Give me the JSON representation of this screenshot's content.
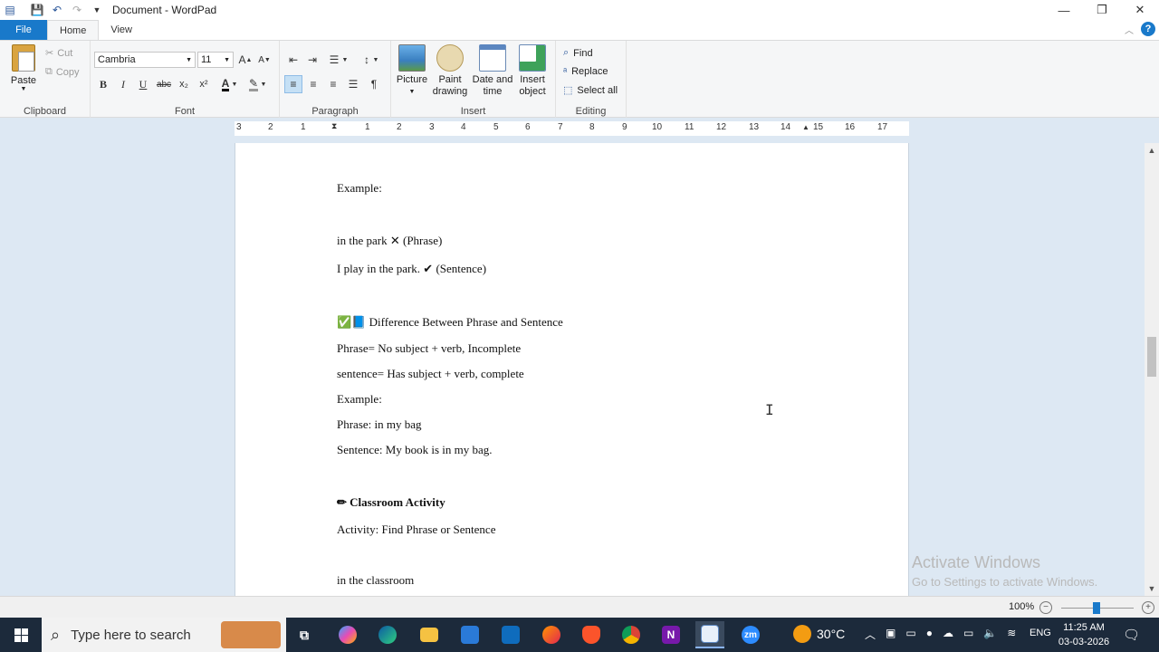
{
  "window": {
    "title": "Document - WordPad",
    "controls": [
      "—",
      "❐",
      "✕"
    ]
  },
  "ribbon_tabs": {
    "file": "File",
    "home": "Home",
    "view": "View"
  },
  "clipboard": {
    "paste": "Paste",
    "cut": "Cut",
    "copy": "Copy",
    "group": "Clipboard"
  },
  "font": {
    "family": "Cambria",
    "size": "11",
    "bold": "B",
    "italic": "I",
    "underline": "U",
    "strike": "abc",
    "subscript": "x₂",
    "superscript": "x²",
    "color": "A",
    "highlight": "✎",
    "grow": "A",
    "shrink": "A",
    "group": "Font"
  },
  "paragraph": {
    "group": "Paragraph"
  },
  "insert": {
    "picture": "Picture",
    "paint_line1": "Paint",
    "paint_line2": "drawing",
    "datetime_line1": "Date and",
    "datetime_line2": "time",
    "object_line1": "Insert",
    "object_line2": "object",
    "group": "Insert"
  },
  "editing": {
    "find": "Find",
    "replace": "Replace",
    "select_all": "Select all",
    "group": "Editing"
  },
  "ruler": {
    "labels": [
      "3",
      "2",
      "1",
      "1",
      "2",
      "3",
      "4",
      "5",
      "6",
      "7",
      "8",
      "9",
      "10",
      "11",
      "12",
      "13",
      "14",
      "15",
      "16",
      "17"
    ]
  },
  "document": {
    "lines": [
      "Example:",
      "in the park ✕ (Phrase)",
      "I play in the park. ✔ (Sentence)",
      "✅📘 Difference Between Phrase and Sentence",
      "Phrase= No subject + verb, Incomplete",
      "sentence= Has subject + verb, complete",
      "Example:",
      "Phrase: in my bag",
      "Sentence: My book is in my bag.",
      "✏ Classroom Activity",
      "Activity: Find Phrase or Sentence",
      "in the classroom"
    ]
  },
  "watermark": {
    "line1": "Activate Windows",
    "line2": "Go to Settings to activate Windows."
  },
  "status": {
    "zoom": "100%"
  },
  "taskbar": {
    "search_placeholder": "Type here to search",
    "temperature": "30°C",
    "language": "ENG",
    "time": "11:25 AM",
    "date": "03-03-2026",
    "onenote_label": "N",
    "zoom_label": "zm"
  }
}
